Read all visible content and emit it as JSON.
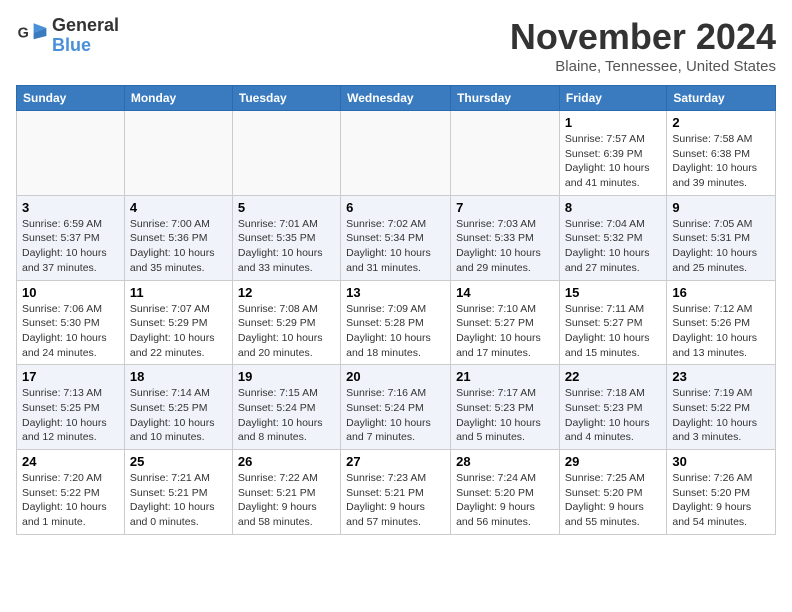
{
  "logo": {
    "name1": "General",
    "name2": "Blue"
  },
  "title": "November 2024",
  "location": "Blaine, Tennessee, United States",
  "days_of_week": [
    "Sunday",
    "Monday",
    "Tuesday",
    "Wednesday",
    "Thursday",
    "Friday",
    "Saturday"
  ],
  "weeks": [
    [
      {
        "day": "",
        "info": ""
      },
      {
        "day": "",
        "info": ""
      },
      {
        "day": "",
        "info": ""
      },
      {
        "day": "",
        "info": ""
      },
      {
        "day": "",
        "info": ""
      },
      {
        "day": "1",
        "info": "Sunrise: 7:57 AM\nSunset: 6:39 PM\nDaylight: 10 hours\nand 41 minutes."
      },
      {
        "day": "2",
        "info": "Sunrise: 7:58 AM\nSunset: 6:38 PM\nDaylight: 10 hours\nand 39 minutes."
      }
    ],
    [
      {
        "day": "3",
        "info": "Sunrise: 6:59 AM\nSunset: 5:37 PM\nDaylight: 10 hours\nand 37 minutes."
      },
      {
        "day": "4",
        "info": "Sunrise: 7:00 AM\nSunset: 5:36 PM\nDaylight: 10 hours\nand 35 minutes."
      },
      {
        "day": "5",
        "info": "Sunrise: 7:01 AM\nSunset: 5:35 PM\nDaylight: 10 hours\nand 33 minutes."
      },
      {
        "day": "6",
        "info": "Sunrise: 7:02 AM\nSunset: 5:34 PM\nDaylight: 10 hours\nand 31 minutes."
      },
      {
        "day": "7",
        "info": "Sunrise: 7:03 AM\nSunset: 5:33 PM\nDaylight: 10 hours\nand 29 minutes."
      },
      {
        "day": "8",
        "info": "Sunrise: 7:04 AM\nSunset: 5:32 PM\nDaylight: 10 hours\nand 27 minutes."
      },
      {
        "day": "9",
        "info": "Sunrise: 7:05 AM\nSunset: 5:31 PM\nDaylight: 10 hours\nand 25 minutes."
      }
    ],
    [
      {
        "day": "10",
        "info": "Sunrise: 7:06 AM\nSunset: 5:30 PM\nDaylight: 10 hours\nand 24 minutes."
      },
      {
        "day": "11",
        "info": "Sunrise: 7:07 AM\nSunset: 5:29 PM\nDaylight: 10 hours\nand 22 minutes."
      },
      {
        "day": "12",
        "info": "Sunrise: 7:08 AM\nSunset: 5:29 PM\nDaylight: 10 hours\nand 20 minutes."
      },
      {
        "day": "13",
        "info": "Sunrise: 7:09 AM\nSunset: 5:28 PM\nDaylight: 10 hours\nand 18 minutes."
      },
      {
        "day": "14",
        "info": "Sunrise: 7:10 AM\nSunset: 5:27 PM\nDaylight: 10 hours\nand 17 minutes."
      },
      {
        "day": "15",
        "info": "Sunrise: 7:11 AM\nSunset: 5:27 PM\nDaylight: 10 hours\nand 15 minutes."
      },
      {
        "day": "16",
        "info": "Sunrise: 7:12 AM\nSunset: 5:26 PM\nDaylight: 10 hours\nand 13 minutes."
      }
    ],
    [
      {
        "day": "17",
        "info": "Sunrise: 7:13 AM\nSunset: 5:25 PM\nDaylight: 10 hours\nand 12 minutes."
      },
      {
        "day": "18",
        "info": "Sunrise: 7:14 AM\nSunset: 5:25 PM\nDaylight: 10 hours\nand 10 minutes."
      },
      {
        "day": "19",
        "info": "Sunrise: 7:15 AM\nSunset: 5:24 PM\nDaylight: 10 hours\nand 8 minutes."
      },
      {
        "day": "20",
        "info": "Sunrise: 7:16 AM\nSunset: 5:24 PM\nDaylight: 10 hours\nand 7 minutes."
      },
      {
        "day": "21",
        "info": "Sunrise: 7:17 AM\nSunset: 5:23 PM\nDaylight: 10 hours\nand 5 minutes."
      },
      {
        "day": "22",
        "info": "Sunrise: 7:18 AM\nSunset: 5:23 PM\nDaylight: 10 hours\nand 4 minutes."
      },
      {
        "day": "23",
        "info": "Sunrise: 7:19 AM\nSunset: 5:22 PM\nDaylight: 10 hours\nand 3 minutes."
      }
    ],
    [
      {
        "day": "24",
        "info": "Sunrise: 7:20 AM\nSunset: 5:22 PM\nDaylight: 10 hours\nand 1 minute."
      },
      {
        "day": "25",
        "info": "Sunrise: 7:21 AM\nSunset: 5:21 PM\nDaylight: 10 hours\nand 0 minutes."
      },
      {
        "day": "26",
        "info": "Sunrise: 7:22 AM\nSunset: 5:21 PM\nDaylight: 9 hours\nand 58 minutes."
      },
      {
        "day": "27",
        "info": "Sunrise: 7:23 AM\nSunset: 5:21 PM\nDaylight: 9 hours\nand 57 minutes."
      },
      {
        "day": "28",
        "info": "Sunrise: 7:24 AM\nSunset: 5:20 PM\nDaylight: 9 hours\nand 56 minutes."
      },
      {
        "day": "29",
        "info": "Sunrise: 7:25 AM\nSunset: 5:20 PM\nDaylight: 9 hours\nand 55 minutes."
      },
      {
        "day": "30",
        "info": "Sunrise: 7:26 AM\nSunset: 5:20 PM\nDaylight: 9 hours\nand 54 minutes."
      }
    ]
  ]
}
